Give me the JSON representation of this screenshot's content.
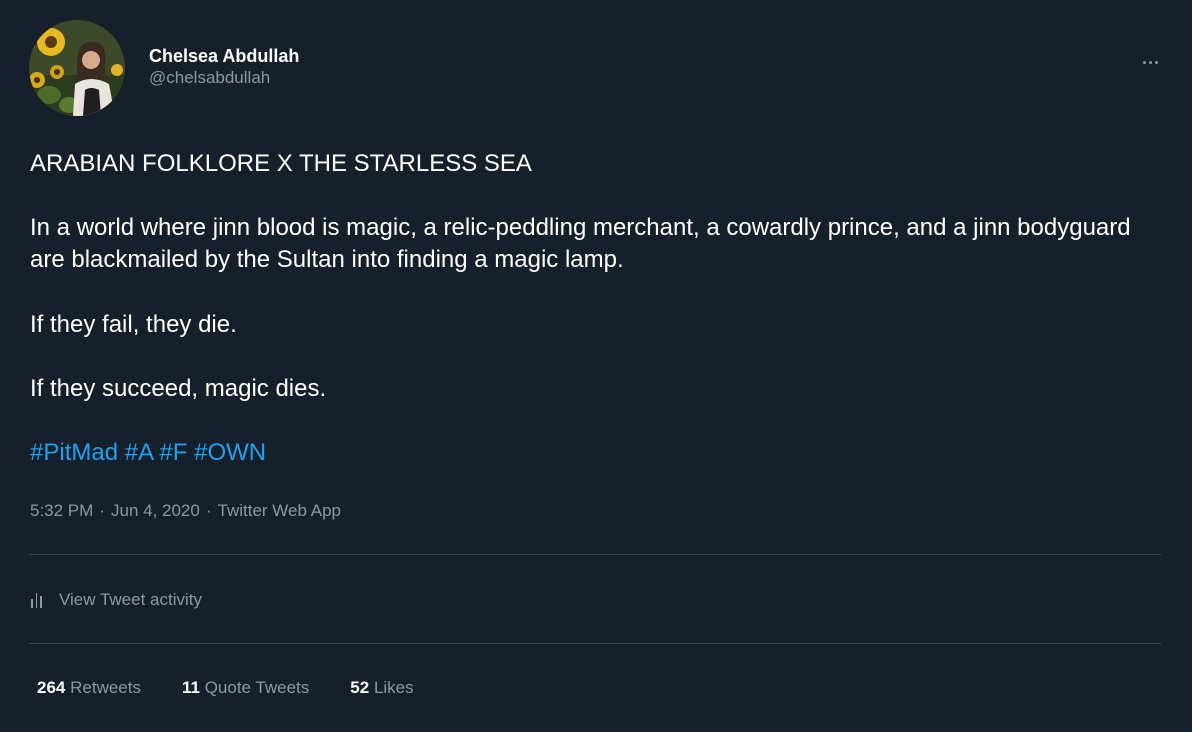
{
  "author": {
    "display_name": "Chelsea Abdullah",
    "handle": "@chelsabdullah",
    "avatar_icon": "profile-photo-sunflowers"
  },
  "more_icon": "ellipsis-icon",
  "tweet": {
    "title_line": "ARABIAN FOLKLORE X THE STARLESS SEA",
    "paragraph_1": "In a world where jinn blood is magic, a relic-peddling merchant, a cowardly prince, and a jinn bodyguard are blackmailed by the Sultan into finding a magic lamp.",
    "paragraph_2": "If they fail, they die.",
    "paragraph_3": "If they succeed, magic dies.",
    "hashtags": [
      "#PitMad",
      "#A",
      "#F",
      "#OWN"
    ]
  },
  "meta": {
    "time": "5:32 PM",
    "date": "Jun 4, 2020",
    "source": "Twitter Web App",
    "separator": "·"
  },
  "activity": {
    "label": "View Tweet activity",
    "icon": "bar-chart-icon"
  },
  "stats": {
    "retweets_count": "264",
    "retweets_label": "Retweets",
    "quotes_count": "11",
    "quotes_label": "Quote Tweets",
    "likes_count": "52",
    "likes_label": "Likes"
  },
  "colors": {
    "background": "#15202b",
    "text": "#ffffff",
    "secondary": "#8899a6",
    "accent": "#1da1f2",
    "divider": "#38444d"
  }
}
